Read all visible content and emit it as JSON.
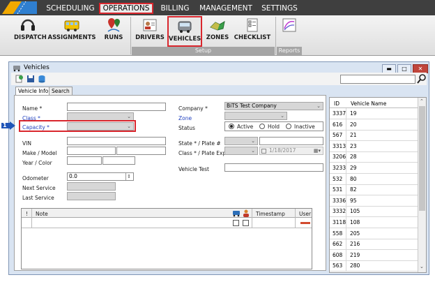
{
  "menubar": {
    "items": [
      "SCHEDULING",
      "OPERATIONS",
      "BILLING",
      "MANAGEMENT",
      "SETTINGS"
    ]
  },
  "ribbon": {
    "buttons": [
      "DISPATCH",
      "ASSIGNMENTS",
      "RUNS",
      "DRIVERS",
      "VEHICLES",
      "ZONES",
      "CHECKLIST"
    ],
    "groups": [
      "Setup",
      "Reports"
    ]
  },
  "window": {
    "title": "Vehicles",
    "tabs": [
      "Vehicle Info",
      "Search"
    ]
  },
  "form": {
    "left": {
      "name": "Name *",
      "class": "Class *",
      "capacity": "Capacity *",
      "vin": "VIN",
      "make_model": "Make / Model",
      "year_color": "Year / Color",
      "odometer": "Odometer",
      "odometer_value": "0.0",
      "next_service": "Next Service",
      "last_service": "Last Service"
    },
    "right": {
      "company": "Company *",
      "company_value": "BiTS Test Company",
      "zone": "Zone",
      "status": "Status",
      "status_options": [
        "Active",
        "Hold",
        "Inactive"
      ],
      "state_plate": "State * / Plate #",
      "class_plate_exp": "Class * / Plate Exp.",
      "plate_exp_value": "1/18/2017",
      "vehicle_test": "Vehicle Test"
    },
    "notes_grid": {
      "columns": [
        "!",
        "Note",
        "Timestamp",
        "User"
      ]
    }
  },
  "marker": {
    "number": "1"
  },
  "vehicle_list": {
    "columns": [
      "ID",
      "Vehicle Name"
    ],
    "rows": [
      [
        "3337",
        "19"
      ],
      [
        "616",
        "20"
      ],
      [
        "567",
        "21"
      ],
      [
        "3313",
        "23"
      ],
      [
        "3206",
        "28"
      ],
      [
        "3233",
        "29"
      ],
      [
        "532",
        "80"
      ],
      [
        "531",
        "82"
      ],
      [
        "3336",
        "95"
      ],
      [
        "3332",
        "105"
      ],
      [
        "3118",
        "108"
      ],
      [
        "558",
        "205"
      ],
      [
        "662",
        "216"
      ],
      [
        "608",
        "219"
      ],
      [
        "563",
        "280"
      ]
    ]
  },
  "colors": {
    "highlight": "#d9262d",
    "menubar": "#3f3f3f",
    "link_label": "#1f3fbf"
  }
}
